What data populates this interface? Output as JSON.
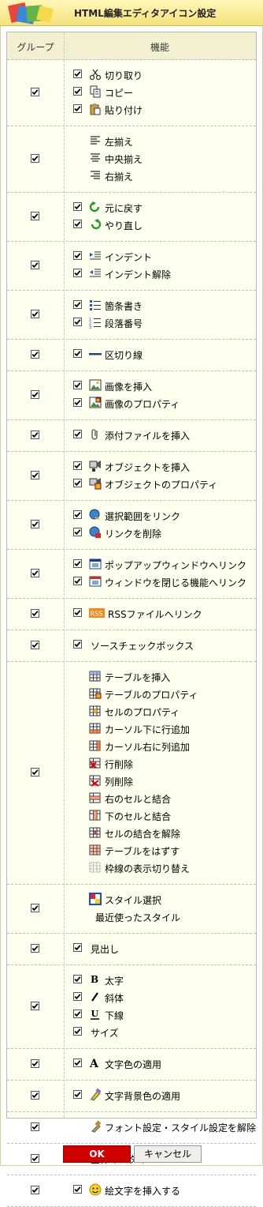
{
  "header": {
    "title": "HTML編集エディタアイコン設定"
  },
  "table": {
    "col_group": "グループ",
    "col_function": "機能"
  },
  "groups": [
    {
      "checked": true,
      "items": [
        {
          "checked": true,
          "icon": "scissors-icon",
          "label": "切り取り"
        },
        {
          "checked": true,
          "icon": "copy-icon",
          "label": "コピー"
        },
        {
          "checked": true,
          "icon": "paste-icon",
          "label": "貼り付け"
        }
      ]
    },
    {
      "checked": true,
      "items": [
        {
          "checked": null,
          "icon": "align-left-icon",
          "label": "左揃え"
        },
        {
          "checked": null,
          "icon": "align-center-icon",
          "label": "中央揃え"
        },
        {
          "checked": null,
          "icon": "align-right-icon",
          "label": "右揃え"
        }
      ]
    },
    {
      "checked": true,
      "items": [
        {
          "checked": true,
          "icon": "undo-icon",
          "label": "元に戻す"
        },
        {
          "checked": true,
          "icon": "redo-icon",
          "label": "やり直し"
        }
      ]
    },
    {
      "checked": true,
      "items": [
        {
          "checked": true,
          "icon": "indent-icon",
          "label": "インデント"
        },
        {
          "checked": true,
          "icon": "outdent-icon",
          "label": "インデント解除"
        }
      ]
    },
    {
      "checked": true,
      "items": [
        {
          "checked": true,
          "icon": "bullet-list-icon",
          "label": "箇条書き"
        },
        {
          "checked": true,
          "icon": "numbered-list-icon",
          "label": "段落番号"
        }
      ]
    },
    {
      "checked": true,
      "items": [
        {
          "checked": true,
          "icon": "horizontal-rule-icon",
          "label": "区切り線"
        }
      ]
    },
    {
      "checked": true,
      "items": [
        {
          "checked": true,
          "icon": "insert-image-icon",
          "label": "画像を挿入"
        },
        {
          "checked": true,
          "icon": "image-properties-icon",
          "label": "画像のプロパティ"
        }
      ]
    },
    {
      "checked": true,
      "items": [
        {
          "checked": true,
          "icon": "paperclip-icon",
          "label": "添付ファイルを挿入"
        }
      ]
    },
    {
      "checked": true,
      "items": [
        {
          "checked": true,
          "icon": "insert-object-icon",
          "label": "オブジェクトを挿入"
        },
        {
          "checked": true,
          "icon": "object-properties-icon",
          "label": "オブジェクトのプロパティ"
        }
      ]
    },
    {
      "checked": true,
      "items": [
        {
          "checked": true,
          "icon": "globe-link-icon",
          "label": "選択範囲をリンク"
        },
        {
          "checked": true,
          "icon": "unlink-icon",
          "label": "リンクを削除"
        }
      ]
    },
    {
      "checked": true,
      "items": [
        {
          "checked": true,
          "icon": "popup-window-icon",
          "label": "ポップアップウィンドウへリンク"
        },
        {
          "checked": true,
          "icon": "close-window-icon",
          "label": "ウィンドウを閉じる機能へリンク"
        }
      ]
    },
    {
      "checked": true,
      "items": [
        {
          "checked": true,
          "icon": "rss-icon",
          "label": "RSSファイルへリンク"
        }
      ]
    },
    {
      "checked": true,
      "items": [
        {
          "checked": true,
          "icon": null,
          "label": "ソースチェックボックス"
        }
      ]
    },
    {
      "checked": true,
      "items": [
        {
          "checked": null,
          "icon": "insert-table-icon",
          "label": "テーブルを挿入"
        },
        {
          "checked": null,
          "icon": "table-properties-icon",
          "label": "テーブルのプロパティ"
        },
        {
          "checked": null,
          "icon": "cell-properties-icon",
          "label": "セルのプロパティ"
        },
        {
          "checked": null,
          "icon": "insert-row-icon",
          "label": "カーソル下に行追加"
        },
        {
          "checked": null,
          "icon": "insert-column-icon",
          "label": "カーソル右に列追加"
        },
        {
          "checked": null,
          "icon": "delete-row-icon",
          "label": "行削除"
        },
        {
          "checked": null,
          "icon": "delete-column-icon",
          "label": "列削除"
        },
        {
          "checked": null,
          "icon": "merge-right-icon",
          "label": "右のセルと結合"
        },
        {
          "checked": null,
          "icon": "merge-down-icon",
          "label": "下のセルと結合"
        },
        {
          "checked": null,
          "icon": "split-cell-icon",
          "label": "セルの結合を解除"
        },
        {
          "checked": null,
          "icon": "remove-table-icon",
          "label": "テーブルをはずす"
        },
        {
          "checked": null,
          "icon": "toggle-borders-icon",
          "label": "枠線の表示切り替え"
        }
      ]
    },
    {
      "checked": true,
      "items": [
        {
          "checked": null,
          "icon": "style-select-icon",
          "label": "スタイル選択"
        },
        {
          "checked": null,
          "icon": null,
          "label": "最近使ったスタイル"
        }
      ]
    },
    {
      "checked": true,
      "items": [
        {
          "checked": true,
          "icon": null,
          "label": "見出し"
        }
      ]
    },
    {
      "checked": true,
      "items": [
        {
          "checked": true,
          "icon": "bold-icon",
          "label": "太字"
        },
        {
          "checked": true,
          "icon": "italic-icon",
          "label": "斜体"
        },
        {
          "checked": true,
          "icon": "underline-icon",
          "label": "下線"
        },
        {
          "checked": true,
          "icon": null,
          "label": "サイズ"
        }
      ]
    },
    {
      "checked": true,
      "items": [
        {
          "checked": true,
          "icon": "text-color-icon",
          "label": "文字色の適用"
        }
      ]
    },
    {
      "checked": true,
      "items": [
        {
          "checked": true,
          "icon": "highlight-color-icon",
          "label": "文字背景色の適用"
        }
      ]
    },
    {
      "checked": true,
      "items": [
        {
          "checked": null,
          "icon": "clear-format-icon",
          "label": "フォント設定・スタイル設定を解除"
        }
      ]
    },
    {
      "checked": true,
      "items": [
        {
          "checked": true,
          "icon": null,
          "label": "全体のスタイル"
        }
      ]
    },
    {
      "checked": true,
      "items": [
        {
          "checked": true,
          "icon": "smiley-icon",
          "label": "絵文字を挿入する"
        }
      ]
    }
  ],
  "buttons": {
    "ok": "OK",
    "cancel": "キャンセル"
  }
}
